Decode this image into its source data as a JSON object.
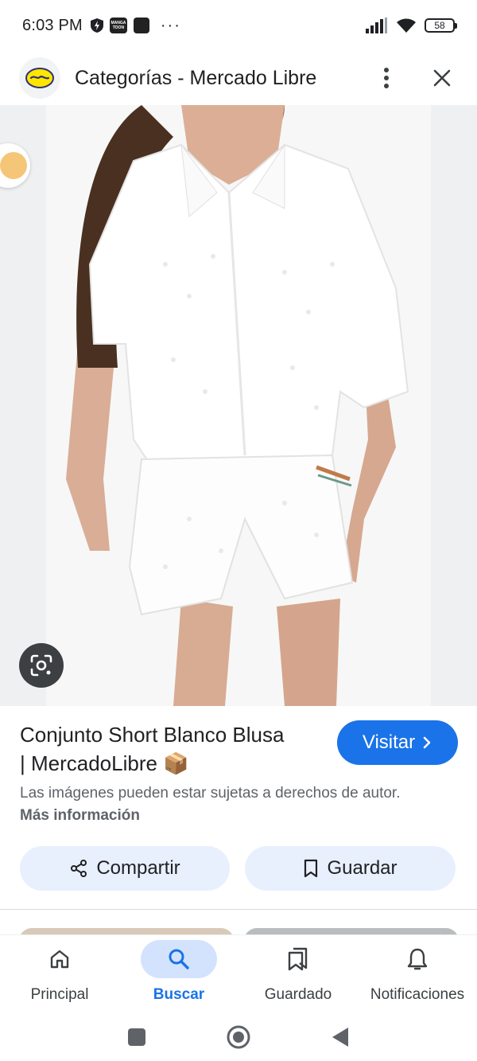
{
  "status_bar": {
    "time": "6:03 PM",
    "manga_icon_text": "MANGA TOON",
    "overflow": "···",
    "battery": "58"
  },
  "title_bar": {
    "title": "Categorías - Mercado Libre"
  },
  "product": {
    "title_line1": "Conjunto Short Blanco Blusa",
    "title_line2": "| MercadoLibre 📦",
    "visit_label": "Visitar",
    "copyright_text": "Las imágenes pueden estar sujetas a derechos de autor.",
    "more_info_label": "Más información"
  },
  "actions": {
    "share_label": "Compartir",
    "save_label": "Guardar"
  },
  "bottom_nav": {
    "items": [
      {
        "label": "Principal",
        "icon": "home-icon",
        "active": false
      },
      {
        "label": "Buscar",
        "icon": "search-icon",
        "active": true
      },
      {
        "label": "Guardado",
        "icon": "bookmarks-icon",
        "active": false
      },
      {
        "label": "Notificaciones",
        "icon": "bell-icon",
        "active": false
      }
    ]
  },
  "colors": {
    "accent": "#1a73e8",
    "chip_bg": "#e8f0fe",
    "active_nav_bg": "#d3e3fd"
  }
}
